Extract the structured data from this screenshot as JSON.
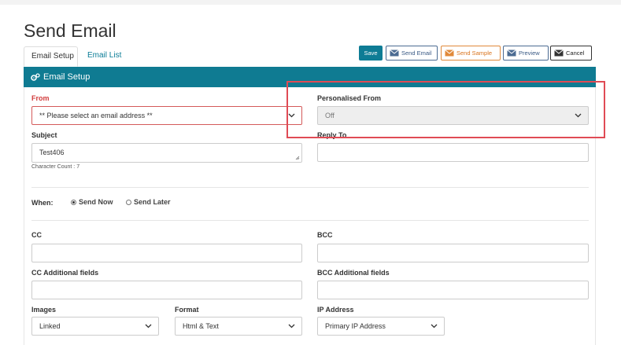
{
  "page": {
    "title": "Send Email"
  },
  "tabs": [
    {
      "label": "Email Setup",
      "active": true
    },
    {
      "label": "Email List",
      "active": false
    }
  ],
  "toolbar": {
    "save": "Save",
    "send_email": "Send Email",
    "send_sample": "Send Sample",
    "preview": "Preview",
    "cancel": "Cancel"
  },
  "section": {
    "title": "Email Setup",
    "icon": "gears-icon"
  },
  "form": {
    "from": {
      "label": "From",
      "value": "** Please select an email address **"
    },
    "personalised_from": {
      "label": "Personalised From",
      "value": "Off"
    },
    "subject": {
      "label": "Subject",
      "value": "Test406",
      "char_count": "Character Count : 7"
    },
    "reply_to": {
      "label": "Reply To",
      "value": ""
    },
    "when": {
      "label": "When:",
      "options": [
        "Send Now",
        "Send Later"
      ],
      "selected": "Send Now"
    },
    "cc": {
      "label": "CC",
      "value": ""
    },
    "bcc": {
      "label": "BCC",
      "value": ""
    },
    "cc_additional": {
      "label": "CC Additional fields",
      "value": ""
    },
    "bcc_additional": {
      "label": "BCC Additional fields",
      "value": ""
    },
    "images": {
      "label": "Images",
      "value": "Linked"
    },
    "format": {
      "label": "Format",
      "value": "Html & Text"
    },
    "ip_address": {
      "label": "IP Address",
      "value": "Primary IP Address"
    }
  },
  "colors": {
    "accent": "#0f7b92",
    "error": "#d23b3b",
    "sample_orange": "#d9741e",
    "highlight": "#e04b55"
  }
}
